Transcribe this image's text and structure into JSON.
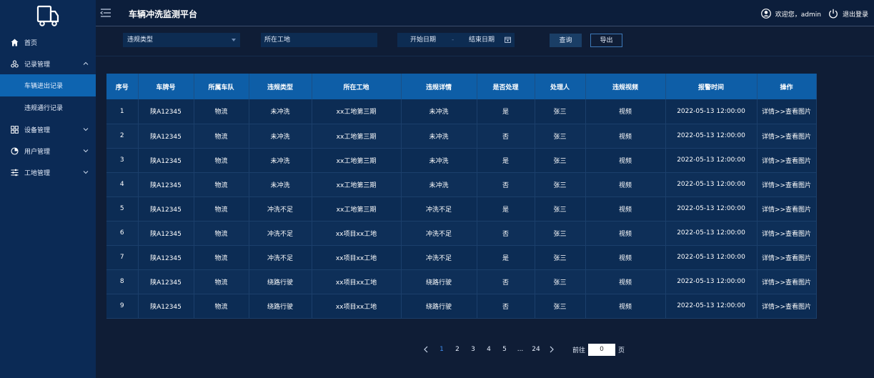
{
  "header": {
    "title": "车辆冲洗监测平台",
    "welcome": "欢迎您，admin",
    "logout": "退出登录"
  },
  "sidebar": {
    "items": [
      {
        "label": "首页",
        "icon": "home-icon"
      },
      {
        "label": "记录管理",
        "icon": "record-icon",
        "expanded": true,
        "children": [
          {
            "label": "车辆进出记录",
            "active": true
          },
          {
            "label": "违规通行记录",
            "active": false
          }
        ]
      },
      {
        "label": "设备管理",
        "icon": "grid-icon"
      },
      {
        "label": "用户管理",
        "icon": "pie-icon"
      },
      {
        "label": "工地管理",
        "icon": "sliders-icon"
      }
    ]
  },
  "filters": {
    "violation_type": "违规类型",
    "site": "所在工地",
    "start_date": "开始日期",
    "date_sep": "-",
    "end_date": "结束日期",
    "query": "查询",
    "export": "导出"
  },
  "table": {
    "columns": [
      "序号",
      "车牌号",
      "所属车队",
      "违规类型",
      "所在工地",
      "违规详情",
      "是否处理",
      "处理人",
      "违规视频",
      "报警时间",
      "操作"
    ],
    "rows": [
      [
        "1",
        "陕A12345",
        "物流",
        "未冲洗",
        "xx工地第三期",
        "未冲洗",
        "是",
        "张三",
        "视频",
        "2022-05-13 12:00:00",
        "详情>>查看图片"
      ],
      [
        "2",
        "陕A12345",
        "物流",
        "未冲洗",
        "xx工地第三期",
        "未冲洗",
        "否",
        "张三",
        "视频",
        "2022-05-13 12:00:00",
        "详情>>查看图片"
      ],
      [
        "3",
        "陕A12345",
        "物流",
        "未冲洗",
        "xx工地第三期",
        "未冲洗",
        "是",
        "张三",
        "视频",
        "2022-05-13 12:00:00",
        "详情>>查看图片"
      ],
      [
        "4",
        "陕A12345",
        "物流",
        "未冲洗",
        "xx工地第三期",
        "未冲洗",
        "否",
        "张三",
        "视频",
        "2022-05-13 12:00:00",
        "详情>>查看图片"
      ],
      [
        "5",
        "陕A12345",
        "物流",
        "冲洗不足",
        "xx工地第三期",
        "冲洗不足",
        "是",
        "张三",
        "视频",
        "2022-05-13 12:00:00",
        "详情>>查看图片"
      ],
      [
        "6",
        "陕A12345",
        "物流",
        "冲洗不足",
        "xx项目xx工地",
        "冲洗不足",
        "否",
        "张三",
        "视频",
        "2022-05-13 12:00:00",
        "详情>>查看图片"
      ],
      [
        "7",
        "陕A12345",
        "物流",
        "冲洗不足",
        "xx项目xx工地",
        "冲洗不足",
        "是",
        "张三",
        "视频",
        "2022-05-13 12:00:00",
        "详情>>查看图片"
      ],
      [
        "8",
        "陕A12345",
        "物流",
        "绕路行驶",
        "xx项目xx工地",
        "绕路行驶",
        "否",
        "张三",
        "视频",
        "2022-05-13 12:00:00",
        "详情>>查看图片"
      ],
      [
        "9",
        "陕A12345",
        "物流",
        "绕路行驶",
        "xx项目xx工地",
        "绕路行驶",
        "否",
        "张三",
        "视频",
        "2022-05-13 12:00:00",
        "详情>>查看图片"
      ]
    ]
  },
  "pagination": {
    "pages": [
      "1",
      "2",
      "3",
      "4",
      "5",
      "...",
      "24"
    ],
    "current": "1",
    "goto_prefix": "前往",
    "goto_value": "0",
    "goto_suffix": "页"
  },
  "colors": {
    "sidebar": "#0b2a55",
    "background": "#0f1d36",
    "table_header": "#0e5ea7",
    "active_menu": "#0e64b0",
    "active_page": "#3f8ef0"
  }
}
